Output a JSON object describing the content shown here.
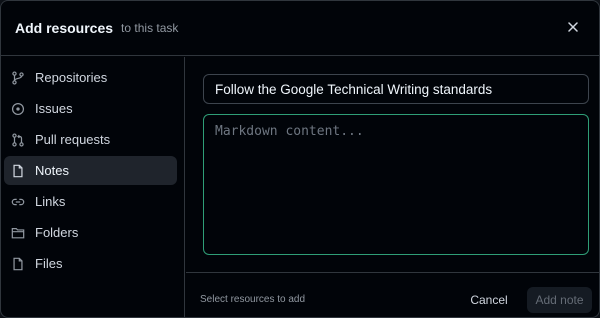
{
  "header": {
    "title": "Add resources",
    "subtitle": "to this task",
    "close_icon": "close-icon"
  },
  "sidebar": {
    "items": [
      {
        "label": "Repositories",
        "icon": "git-branch-icon",
        "active": false
      },
      {
        "label": "Issues",
        "icon": "issue-circle-icon",
        "active": false
      },
      {
        "label": "Pull requests",
        "icon": "pull-request-icon",
        "active": false
      },
      {
        "label": "Notes",
        "icon": "file-icon",
        "active": true
      },
      {
        "label": "Links",
        "icon": "link-icon",
        "active": false
      },
      {
        "label": "Folders",
        "icon": "folder-icon",
        "active": false
      },
      {
        "label": "Files",
        "icon": "file-icon",
        "active": false
      }
    ]
  },
  "form": {
    "title_value": "Follow the Google Technical Writing standards",
    "body_value": "",
    "body_placeholder": "Markdown content..."
  },
  "footer": {
    "hint": "Select resources to add",
    "cancel_label": "Cancel",
    "add_label": "Add note"
  },
  "colors": {
    "accent_border": "#2f9e77",
    "background": "#010409",
    "active_item": "#1f242c"
  }
}
